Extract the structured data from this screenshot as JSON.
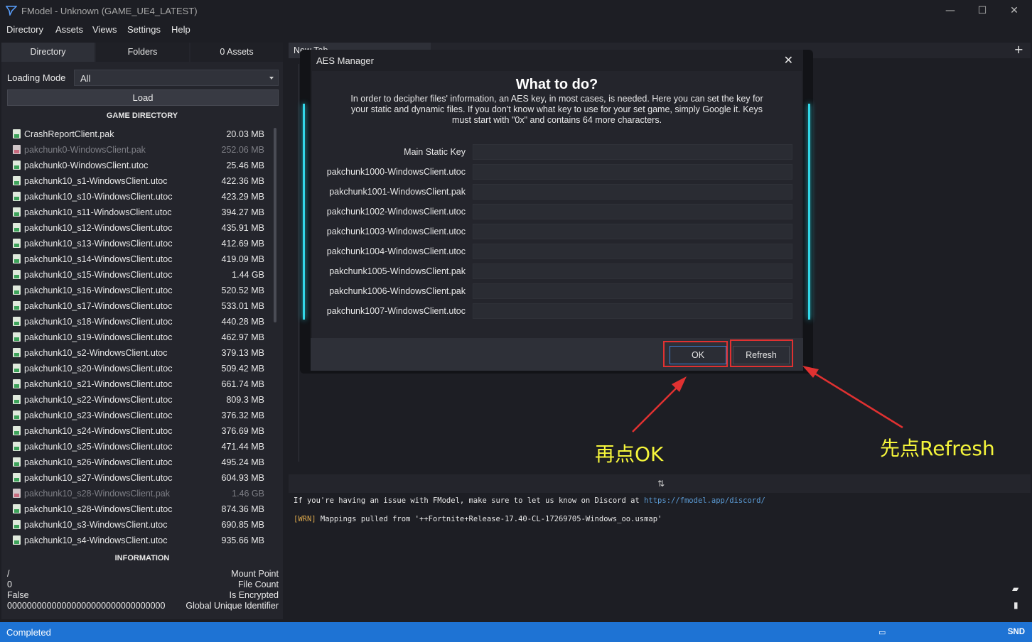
{
  "window": {
    "title": "FModel - Unknown (GAME_UE4_LATEST)"
  },
  "menu": [
    "Directory",
    "Assets",
    "Views",
    "Settings",
    "Help"
  ],
  "left_tabs": [
    "Directory",
    "Folders",
    "0 Assets"
  ],
  "loading_mode": {
    "label": "Loading Mode",
    "value": "All"
  },
  "load_button": "Load",
  "game_directory_title": "GAME DIRECTORY",
  "files": [
    {
      "name": "CrashReportClient.pak",
      "size": "20.03 MB",
      "dim": false
    },
    {
      "name": "pakchunk0-WindowsClient.pak",
      "size": "252.06 MB",
      "dim": true
    },
    {
      "name": "pakchunk0-WindowsClient.utoc",
      "size": "25.46 MB",
      "dim": false
    },
    {
      "name": "pakchunk10_s1-WindowsClient.utoc",
      "size": "422.36 MB",
      "dim": false
    },
    {
      "name": "pakchunk10_s10-WindowsClient.utoc",
      "size": "423.29 MB",
      "dim": false
    },
    {
      "name": "pakchunk10_s11-WindowsClient.utoc",
      "size": "394.27 MB",
      "dim": false
    },
    {
      "name": "pakchunk10_s12-WindowsClient.utoc",
      "size": "435.91 MB",
      "dim": false
    },
    {
      "name": "pakchunk10_s13-WindowsClient.utoc",
      "size": "412.69 MB",
      "dim": false
    },
    {
      "name": "pakchunk10_s14-WindowsClient.utoc",
      "size": "419.09 MB",
      "dim": false
    },
    {
      "name": "pakchunk10_s15-WindowsClient.utoc",
      "size": "1.44 GB",
      "dim": false
    },
    {
      "name": "pakchunk10_s16-WindowsClient.utoc",
      "size": "520.52 MB",
      "dim": false
    },
    {
      "name": "pakchunk10_s17-WindowsClient.utoc",
      "size": "533.01 MB",
      "dim": false
    },
    {
      "name": "pakchunk10_s18-WindowsClient.utoc",
      "size": "440.28 MB",
      "dim": false
    },
    {
      "name": "pakchunk10_s19-WindowsClient.utoc",
      "size": "462.97 MB",
      "dim": false
    },
    {
      "name": "pakchunk10_s2-WindowsClient.utoc",
      "size": "379.13 MB",
      "dim": false
    },
    {
      "name": "pakchunk10_s20-WindowsClient.utoc",
      "size": "509.42 MB",
      "dim": false
    },
    {
      "name": "pakchunk10_s21-WindowsClient.utoc",
      "size": "661.74 MB",
      "dim": false
    },
    {
      "name": "pakchunk10_s22-WindowsClient.utoc",
      "size": "809.3 MB",
      "dim": false
    },
    {
      "name": "pakchunk10_s23-WindowsClient.utoc",
      "size": "376.32 MB",
      "dim": false
    },
    {
      "name": "pakchunk10_s24-WindowsClient.utoc",
      "size": "376.69 MB",
      "dim": false
    },
    {
      "name": "pakchunk10_s25-WindowsClient.utoc",
      "size": "471.44 MB",
      "dim": false
    },
    {
      "name": "pakchunk10_s26-WindowsClient.utoc",
      "size": "495.24 MB",
      "dim": false
    },
    {
      "name": "pakchunk10_s27-WindowsClient.utoc",
      "size": "604.93 MB",
      "dim": false
    },
    {
      "name": "pakchunk10_s28-WindowsClient.pak",
      "size": "1.46 GB",
      "dim": true
    },
    {
      "name": "pakchunk10_s28-WindowsClient.utoc",
      "size": "874.36 MB",
      "dim": false
    },
    {
      "name": "pakchunk10_s3-WindowsClient.utoc",
      "size": "690.85 MB",
      "dim": false
    },
    {
      "name": "pakchunk10_s4-WindowsClient.utoc",
      "size": "935.66 MB",
      "dim": false
    }
  ],
  "information_title": "INFORMATION",
  "information": [
    {
      "value": "/",
      "key": "Mount Point"
    },
    {
      "value": "0",
      "key": "File Count"
    },
    {
      "value": "False",
      "key": "Is Encrypted"
    },
    {
      "value": "00000000000000000000000000000000",
      "key": "Global Unique Identifier"
    }
  ],
  "doc_tab": "New Tab",
  "console": {
    "line1_prefix": "If you're having an issue with FModel, make sure to let us know on Discord at ",
    "line1_link": "https://fmodel.app/discord/",
    "line2_tag": "[WRN]",
    "line2_text": " Mappings pulled from '++Fortnite+Release-17.40-CL-17269705-Windows_oo.usmap'"
  },
  "status": {
    "text": "Completed",
    "right": "SND"
  },
  "dialog": {
    "title": "AES Manager",
    "heading": "What to do?",
    "description": "In order to decipher files' information, an AES key, in most cases, is needed. Here you can set the key for your static and dynamic files. If you don't know what key to use for your set game, simply Google it. Keys must start with \"0x\" and contains 64 more characters.",
    "keys": [
      {
        "label": "Main Static Key",
        "value": ""
      },
      {
        "label": "pakchunk1000-WindowsClient.utoc",
        "value": ""
      },
      {
        "label": "pakchunk1001-WindowsClient.pak",
        "value": ""
      },
      {
        "label": "pakchunk1002-WindowsClient.utoc",
        "value": ""
      },
      {
        "label": "pakchunk1003-WindowsClient.utoc",
        "value": ""
      },
      {
        "label": "pakchunk1004-WindowsClient.utoc",
        "value": ""
      },
      {
        "label": "pakchunk1005-WindowsClient.pak",
        "value": ""
      },
      {
        "label": "pakchunk1006-WindowsClient.pak",
        "value": ""
      },
      {
        "label": "pakchunk1007-WindowsClient.utoc",
        "value": ""
      }
    ],
    "ok": "OK",
    "refresh": "Refresh"
  },
  "annotations": {
    "ok_note": "再点OK",
    "refresh_note": "先点Refresh",
    "highlight_color": "#e03131",
    "note_color": "#f5f53b"
  },
  "colors": {
    "accent": "#1e73d4",
    "glow": "#32d7e8"
  }
}
